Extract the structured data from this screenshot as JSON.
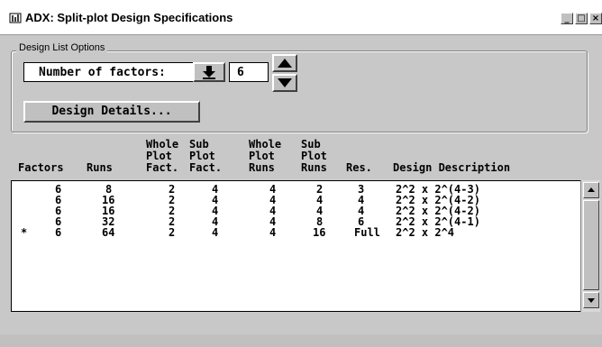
{
  "window": {
    "title": "ADX: Split-plot Design Specifications",
    "min_glyph": "_",
    "max_glyph": "□",
    "close_glyph": "×"
  },
  "design_options": {
    "group_label": "Design List Options",
    "factors_label": "Number of factors:",
    "factors_value": "6",
    "details_button": "Design Details..."
  },
  "table": {
    "headers": {
      "factors": "Factors",
      "runs": "Runs",
      "wp_fact": "Whole\nPlot\nFact.",
      "sp_fact": "Sub\nPlot\nFact.",
      "wp_runs": "Whole\nPlot\nRuns",
      "sp_runs": "Sub\nPlot\nRuns",
      "res": "Res.",
      "desc": "Design Description"
    },
    "rows": [
      {
        "mark": "",
        "factors": "6",
        "runs": "8",
        "wp_fact": "2",
        "sp_fact": "4",
        "wp_runs": "4",
        "sp_runs": "2",
        "res": "3",
        "desc": "2^2 x 2^(4-3)"
      },
      {
        "mark": "",
        "factors": "6",
        "runs": "16",
        "wp_fact": "2",
        "sp_fact": "4",
        "wp_runs": "4",
        "sp_runs": "4",
        "res": "4",
        "desc": "2^2 x 2^(4-2)"
      },
      {
        "mark": "",
        "factors": "6",
        "runs": "16",
        "wp_fact": "2",
        "sp_fact": "4",
        "wp_runs": "4",
        "sp_runs": "4",
        "res": "4",
        "desc": "2^2 x 2^(4-2)"
      },
      {
        "mark": "",
        "factors": "6",
        "runs": "32",
        "wp_fact": "2",
        "sp_fact": "4",
        "wp_runs": "4",
        "sp_runs": "8",
        "res": "6",
        "desc": "2^2 x 2^(4-1)"
      },
      {
        "mark": "*",
        "factors": "6",
        "runs": "64",
        "wp_fact": "2",
        "sp_fact": "4",
        "wp_runs": "4",
        "sp_runs": "16",
        "res": "Full",
        "desc": "2^2 x 2^4"
      }
    ]
  }
}
